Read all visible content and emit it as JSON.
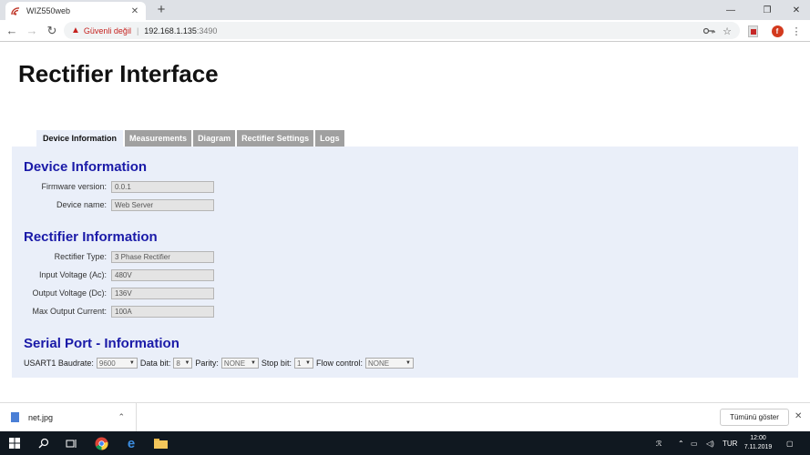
{
  "browser": {
    "tab_title": "WIZ550web",
    "address": {
      "security_label": "Güvenli değil",
      "host": "192.168.1.135",
      "port": ":3490"
    }
  },
  "page": {
    "title": "Rectifier Interface",
    "tabs": [
      {
        "label": "Device Information",
        "active": true
      },
      {
        "label": "Measurements"
      },
      {
        "label": "Diagram"
      },
      {
        "label": "Rectifier Settings"
      },
      {
        "label": "Logs"
      }
    ],
    "device_info": {
      "heading": "Device Information",
      "fields": [
        {
          "label": "Firmware version:",
          "value": "0.0.1"
        },
        {
          "label": "Device name:",
          "value": "Web Server"
        }
      ]
    },
    "rectifier_info": {
      "heading": "Rectifier Information",
      "fields": [
        {
          "label": "Rectifier Type:",
          "value": "3 Phase Rectifier"
        },
        {
          "label": "Input Voltage (Ac):",
          "value": "480V"
        },
        {
          "label": "Output Voltage (Dc):",
          "value": "136V"
        },
        {
          "label": "Max Output Current:",
          "value": "100A"
        }
      ]
    },
    "serial_port": {
      "heading": "Serial Port - Information",
      "baudrate_label": "USART1 Baudrate:",
      "baudrate_value": "9600",
      "databit_label": "Data bit:",
      "databit_value": "8",
      "parity_label": "Parity:",
      "parity_value": "NONE",
      "stopbit_label": "Stop bit:",
      "stopbit_value": "1",
      "flow_label": "Flow control:",
      "flow_value": "NONE"
    }
  },
  "downloads": {
    "file_name": "net.jpg",
    "show_all_label": "Tümünü göster"
  },
  "taskbar": {
    "language": "TUR",
    "time": "12:00",
    "date": "7.11.2019"
  },
  "colors": {
    "heading": "#1a1aa8",
    "panel_bg": "#eaeff9",
    "inactive_tab": "#a0a0a0"
  }
}
